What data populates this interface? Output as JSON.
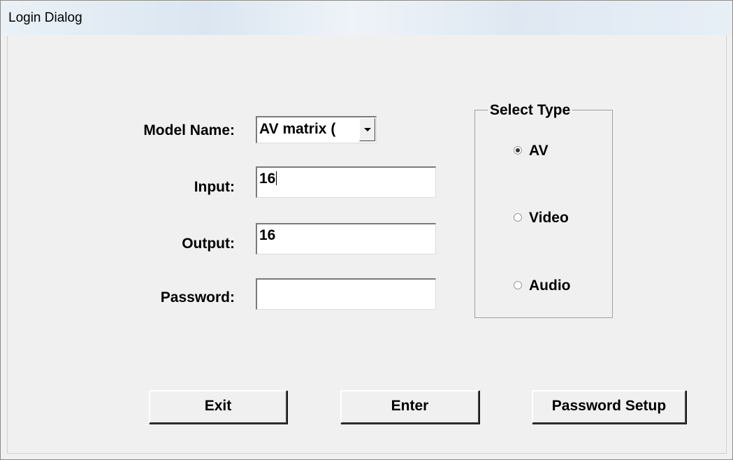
{
  "window": {
    "title": "Login Dialog"
  },
  "form": {
    "model_label": "Model Name:",
    "model_value": "AV matrix (",
    "input_label": "Input:",
    "input_value": "16",
    "output_label": "Output:",
    "output_value": "16",
    "password_label": "Password:",
    "password_value": ""
  },
  "select_type": {
    "title": "Select Type",
    "options": [
      {
        "label": "AV",
        "checked": true
      },
      {
        "label": "Video",
        "checked": false
      },
      {
        "label": "Audio",
        "checked": false
      }
    ]
  },
  "buttons": {
    "exit": "Exit",
    "enter": "Enter",
    "password_setup": "Password Setup"
  }
}
